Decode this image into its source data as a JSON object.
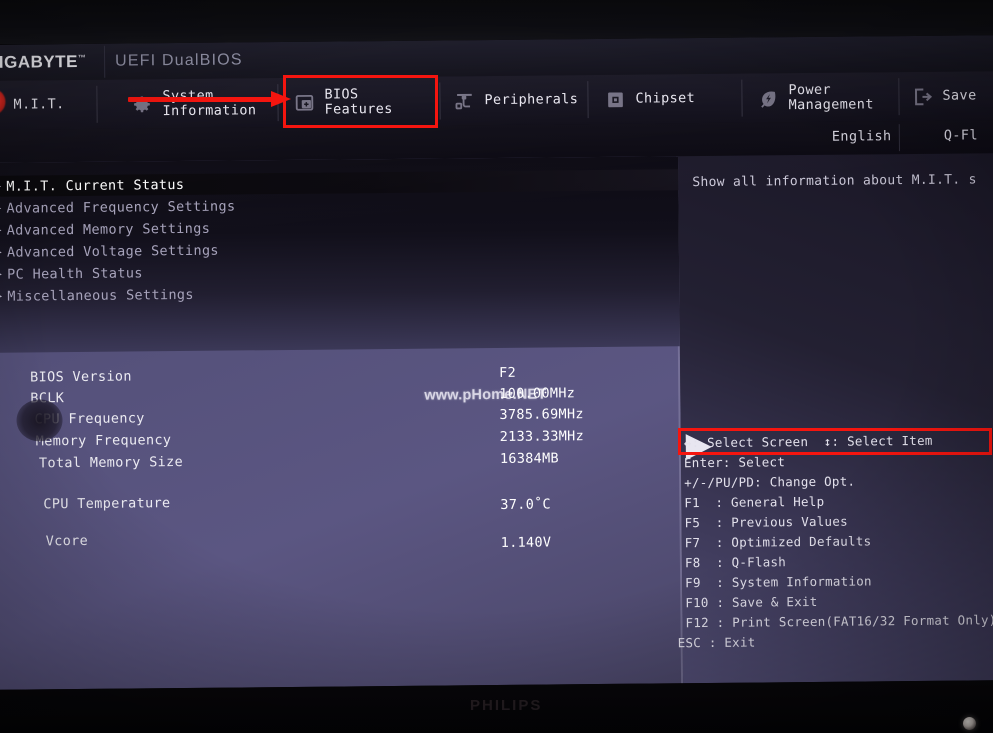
{
  "brand": {
    "logo": "GIGABYTE",
    "trademark": "™",
    "uefi_title": "UEFI DualBIOS"
  },
  "nav": {
    "items": [
      {
        "label": "M.I.T.",
        "icon": "cpu-tuning-icon",
        "active": true
      },
      {
        "label": "System\nInformation",
        "icon": "gear-icon",
        "active": false
      },
      {
        "label": "BIOS\nFeatures",
        "icon": "chip-plus-icon",
        "active": false,
        "highlighted": true
      },
      {
        "label": "Peripherals",
        "icon": "plug-icon",
        "active": false
      },
      {
        "label": "Chipset",
        "icon": "chipset-icon",
        "active": false
      },
      {
        "label": "Power\nManagement",
        "icon": "power-leaf-icon",
        "active": false
      },
      {
        "label": "Save",
        "icon": "exit-arrow-icon",
        "active": false
      }
    ]
  },
  "sub_bar": {
    "language": "English",
    "qflash": "Q-Fl"
  },
  "menu": {
    "items": [
      {
        "label": "M.I.T. Current Status",
        "selected": true
      },
      {
        "label": "Advanced Frequency Settings",
        "selected": false
      },
      {
        "label": "Advanced Memory Settings",
        "selected": false
      },
      {
        "label": "Advanced Voltage Settings",
        "selected": false
      },
      {
        "label": "PC Health Status",
        "selected": false
      },
      {
        "label": "Miscellaneous Settings",
        "selected": false
      }
    ]
  },
  "help": {
    "text": "Show all information about M.I.T. s"
  },
  "watermark": "www.pHome.NET",
  "info": {
    "rows": [
      {
        "label": "BIOS Version",
        "value": "F2"
      },
      {
        "label": "BCLK",
        "value": "100.00MHz"
      },
      {
        "label": "CPU Frequency",
        "value": "3785.69MHz"
      },
      {
        "label": "Memory Frequency",
        "value": "2133.33MHz"
      },
      {
        "label": "Total Memory Size",
        "value": "16384MB"
      },
      {
        "label": "CPU Temperature",
        "value": "37.0˚C"
      },
      {
        "label": "Vcore",
        "value": "1.140V"
      }
    ]
  },
  "hotkeys": {
    "rows": [
      "↔: Select Screen  ↕: Select Item",
      "Enter: Select",
      "+/-/PU/PD: Change Opt.",
      "F1  : General Help",
      "F5  : Previous Values",
      "F7  : Optimized Defaults",
      "F8  : Q-Flash",
      "F9  : System Information",
      "F10 : Save & Exit",
      "F12 : Print Screen(FAT16/32 Format Only)",
      "ESC : Exit"
    ]
  },
  "monitor": {
    "brand": "PHILIPS"
  },
  "annotations": {
    "highlight_color": "#f5150f",
    "boxes": [
      "bios-features-tab",
      "select-screen-hotkey-row"
    ],
    "arrows": [
      "arrow-to-bios-features"
    ]
  }
}
